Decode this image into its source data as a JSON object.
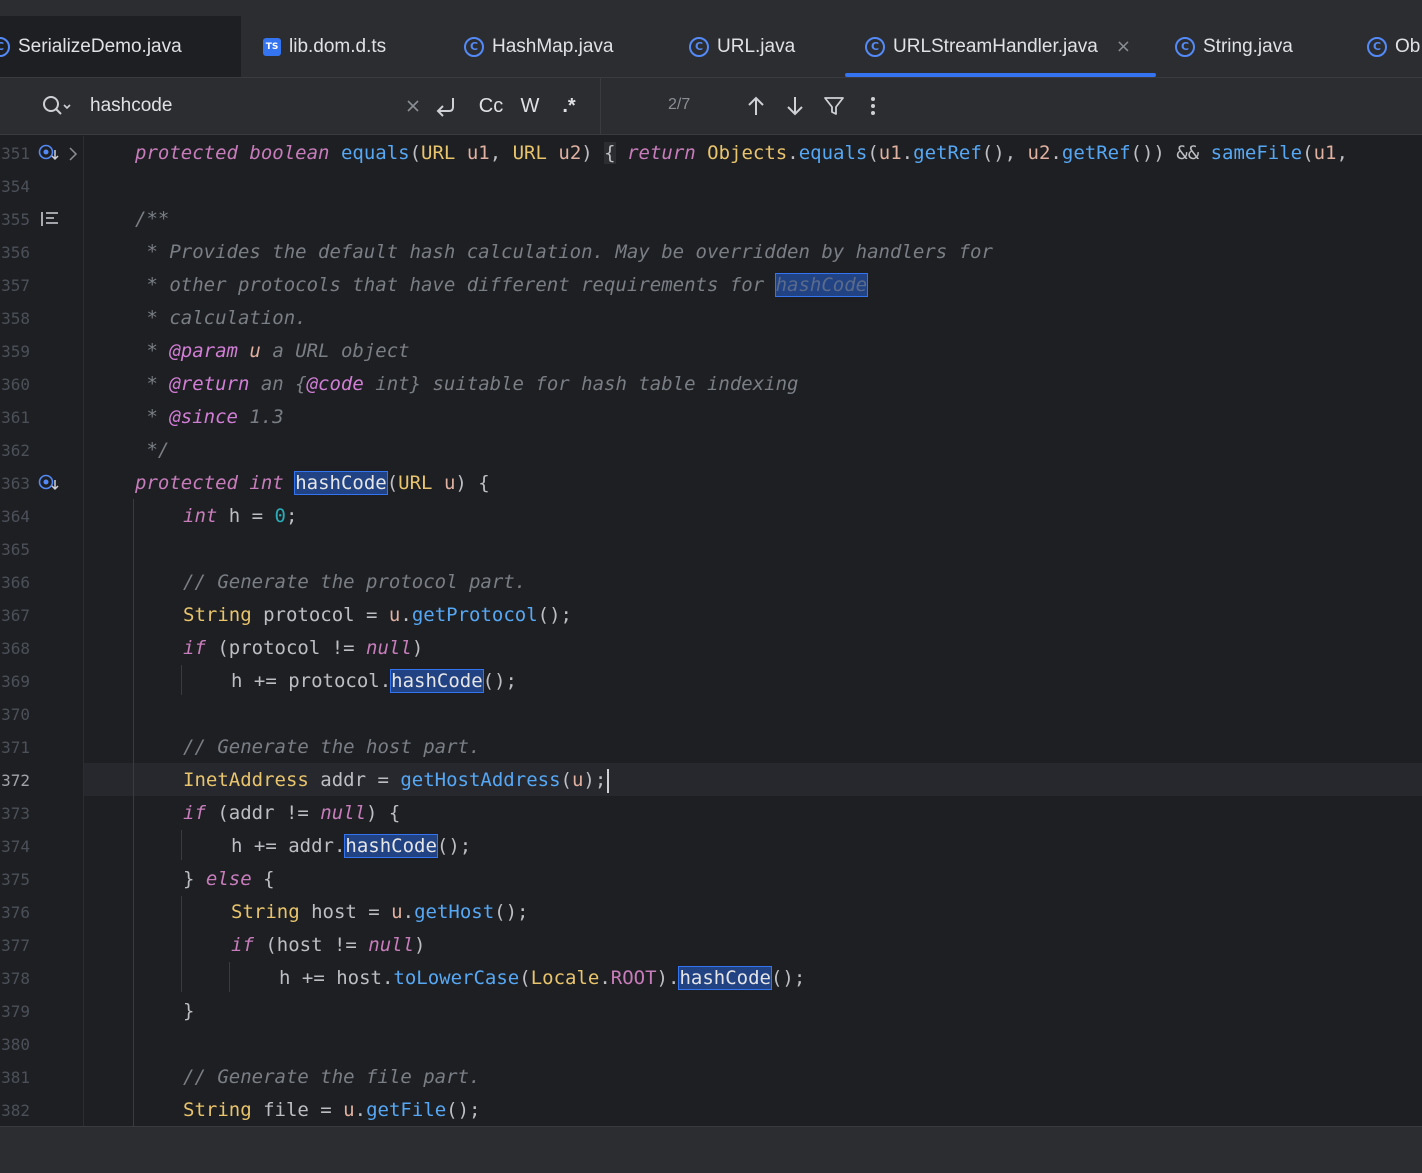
{
  "tabs": [
    {
      "label": "SerializeDemo.java",
      "icon": "class-icon",
      "active": false
    },
    {
      "label": "lib.dom.d.ts",
      "icon": "ts-icon",
      "active": false
    },
    {
      "label": "HashMap.java",
      "icon": "class-icon",
      "active": false
    },
    {
      "label": "URL.java",
      "icon": "class-icon",
      "active": false
    },
    {
      "label": "URLStreamHandler.java",
      "icon": "class-icon",
      "active": true
    },
    {
      "label": "String.java",
      "icon": "class-icon",
      "active": false
    },
    {
      "label": "Ob",
      "icon": "class-icon",
      "active": false
    }
  ],
  "icon_glyphs": {
    "class": "C",
    "ts": "TS",
    "close": "×"
  },
  "search": {
    "value": "hashcode",
    "match_case_label": "Cc",
    "words_label": "W",
    "regex_label": ".*",
    "match_count": "2/7"
  },
  "colors": {
    "accent": "#3574f0",
    "editor_bg": "#1e1f22",
    "panel_bg": "#2b2d30",
    "keyword": "#c77dbb",
    "type": "#e8c46c",
    "function": "#56a8f5",
    "comment": "#7a7e85"
  },
  "gutter": {
    "line_numbers": [
      "351",
      "354",
      "355",
      "356",
      "357",
      "358",
      "359",
      "360",
      "361",
      "362",
      "363",
      "364",
      "365",
      "366",
      "367",
      "368",
      "369",
      "370",
      "371",
      "372",
      "373",
      "374",
      "375",
      "376",
      "377",
      "378",
      "379",
      "380",
      "381",
      "382"
    ],
    "current_line": "372"
  },
  "code": {
    "l351": {
      "protected": "protected",
      "boolean": "boolean",
      "equals": "equals",
      "p1": "(",
      "URL1": "URL",
      "u1": "u1",
      "c1": ", ",
      "URL2": "URL",
      "u2": "u2",
      "p2": ") ",
      "ob": "{",
      "return": "return",
      "Objects": "Objects",
      "dot1": ".",
      "equals2": "equals",
      "p3": "(",
      "u1b": "u1",
      "dot2": ".",
      "getRef1": "getRef",
      "p4": "(), ",
      "u2b": "u2",
      "dot3": ".",
      "getRef2": "getRef",
      "p5": "()) && ",
      "sameFile": "sameFile",
      "p6": "(",
      "u1c": "u1",
      "tail": ","
    },
    "l355": "/**",
    "l356": " * Provides the default hash calculation. May be overridden by handlers for",
    "l357a": " * other protocols that have different requirements for ",
    "l357b": "hashCode",
    "l358": " * calculation.",
    "l359": {
      "star": " * ",
      "tag": "@param",
      "param": "u",
      "rest": " a URL object"
    },
    "l360": {
      "star": " * ",
      "tag": "@return",
      "rest1": " an {",
      "code": "@code",
      "rest2": " int} suitable for hash table indexing"
    },
    "l361": {
      "star": " * ",
      "tag": "@since",
      "rest": " 1.3"
    },
    "l362": " */",
    "l363": {
      "protected": "protected",
      "int": "int",
      "name": "hashCode",
      "p1": "(",
      "URL": "URL",
      "u": "u",
      "p2": ") {"
    },
    "l364": {
      "int": "int",
      "h": " h = ",
      "zero": "0",
      "end": ";"
    },
    "l366": "// Generate the protocol part.",
    "l367": {
      "String": "String",
      "protocol": " protocol = ",
      "u": "u",
      "dot": ".",
      "getProtocol": "getProtocol",
      "end": "();"
    },
    "l368": {
      "if": "if",
      "cond": " (protocol != ",
      "null": "null",
      "end": ")"
    },
    "l369": {
      "pre": "h += protocol.",
      "hashCode": "hashCode",
      "end": "();"
    },
    "l371": "// Generate the host part.",
    "l372": {
      "InetAddress": "InetAddress",
      "addr": " addr = ",
      "getHostAddress": "getHostAddress",
      "p": "(",
      "u": "u",
      "end": ");"
    },
    "l373": {
      "if": "if",
      "cond": " (addr != ",
      "null": "null",
      "end": ") {"
    },
    "l374": {
      "pre": "h += addr.",
      "hashCode": "hashCode",
      "end": "();"
    },
    "l375": {
      "close": "} ",
      "else": "else",
      "end": " {"
    },
    "l376": {
      "String": "String",
      "host": " host = ",
      "u": "u",
      "dot": ".",
      "getHost": "getHost",
      "end": "();"
    },
    "l377": {
      "if": "if",
      "cond": " (host != ",
      "null": "null",
      "end": ")"
    },
    "l378": {
      "pre": "h += host.",
      "toLowerCase": "toLowerCase",
      "p1": "(",
      "Locale": "Locale",
      "dot": ".",
      "ROOT": "ROOT",
      "p2": ").",
      "hashCode": "hashCode",
      "end": "();"
    },
    "l379": "}",
    "l381": "// Generate the file part.",
    "l382": {
      "String": "String",
      "file": " file = ",
      "u": "u",
      "dot": ".",
      "getFile": "getFile",
      "end": "();"
    }
  }
}
